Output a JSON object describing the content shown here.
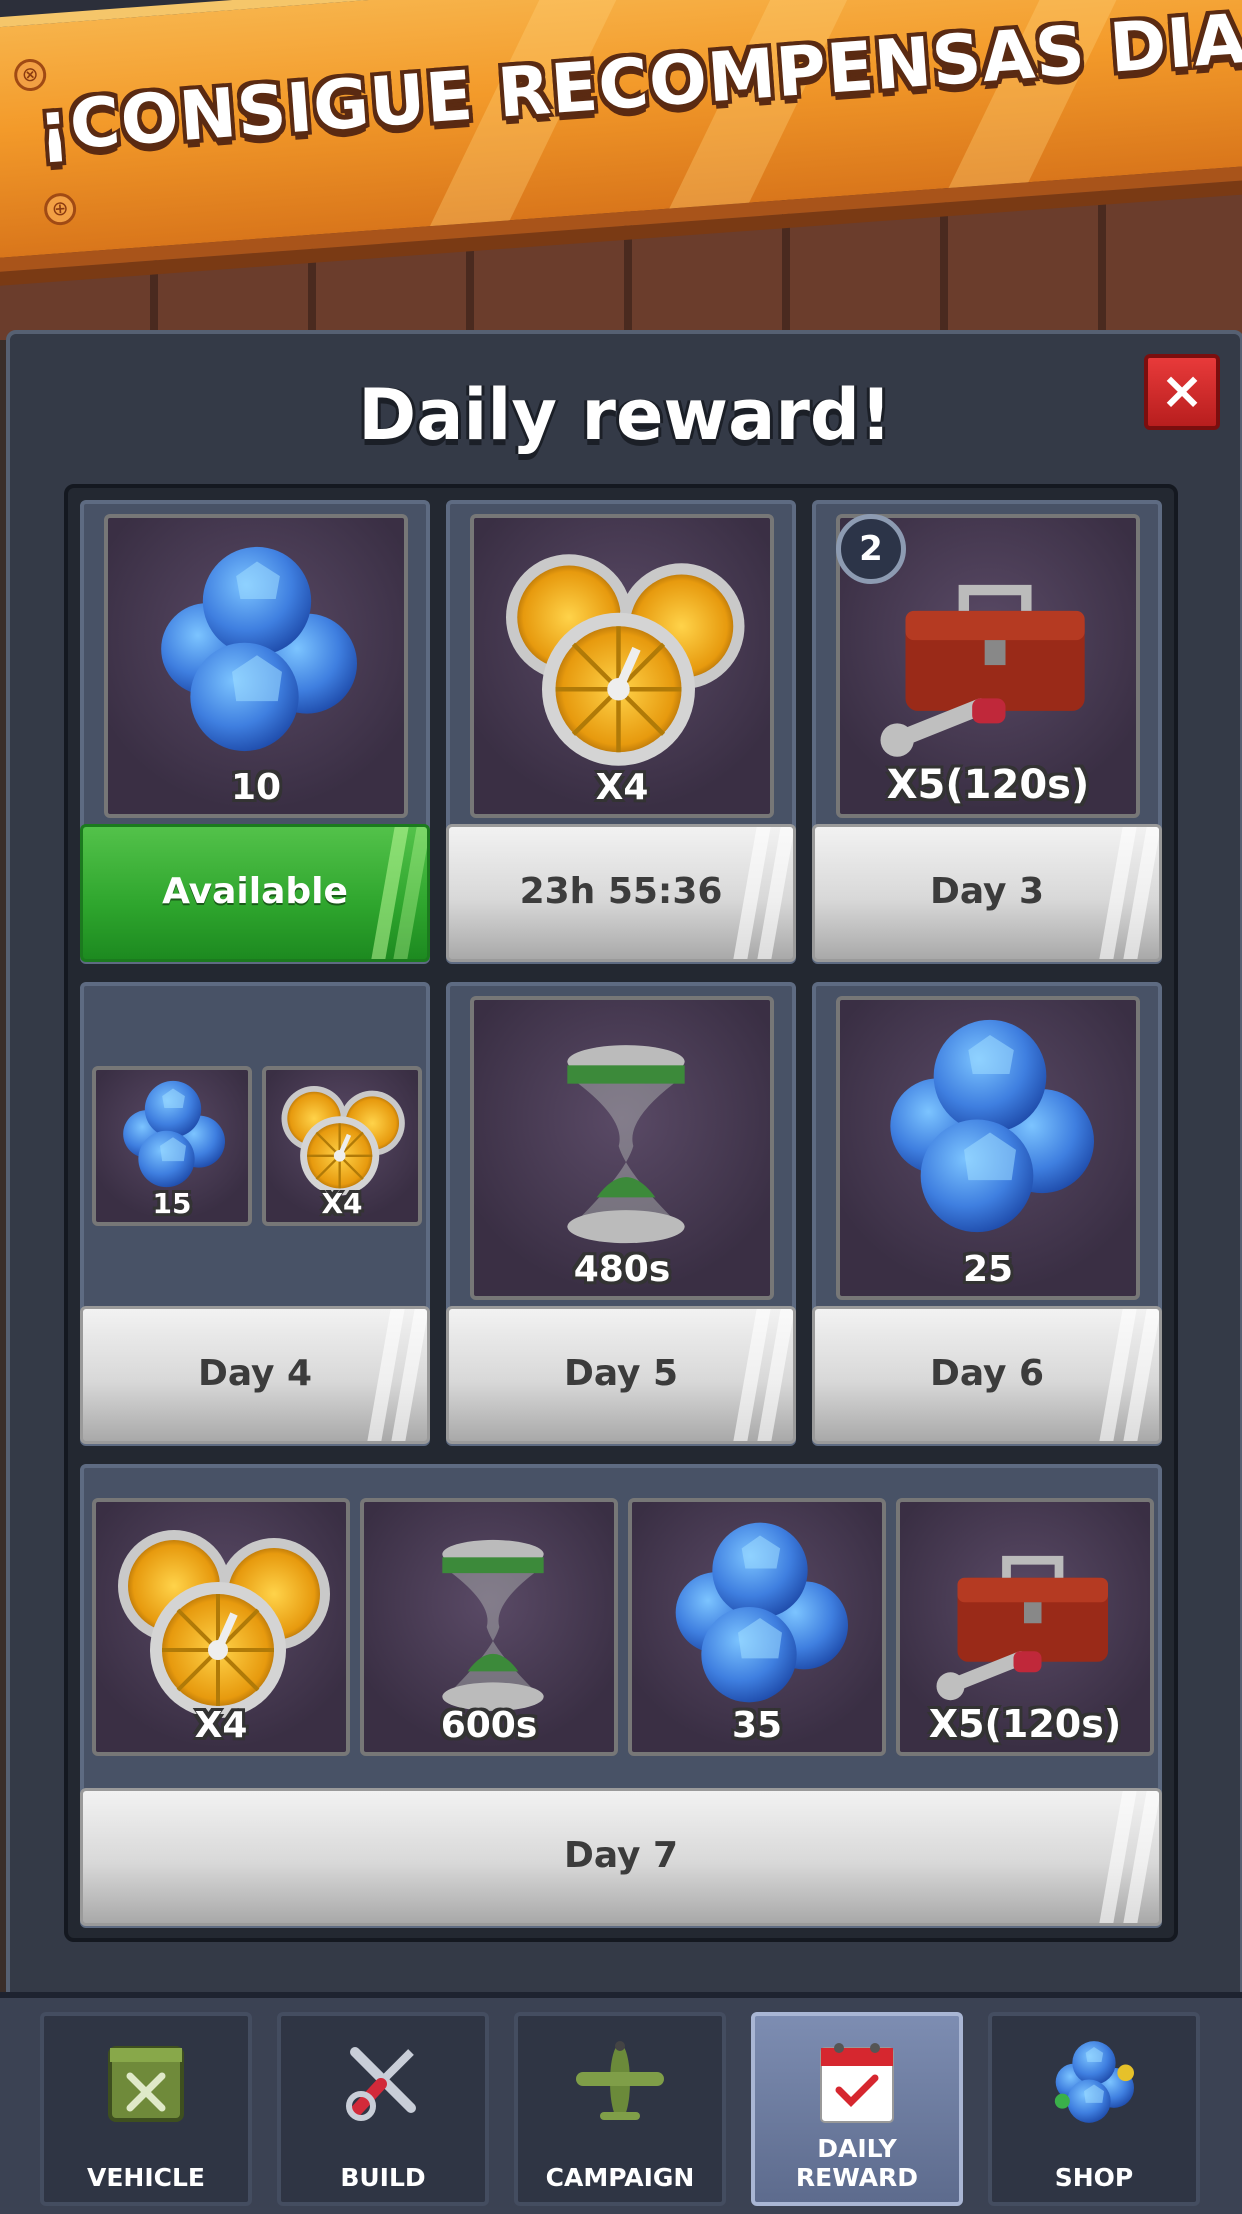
{
  "banner": {
    "text": "¡CONSIGUE RECOMPENSAS DIARIAS!"
  },
  "dialog": {
    "title": "Daily reward!",
    "close_label": "×"
  },
  "days": [
    {
      "reward_qty": "10",
      "button_label": "Available",
      "state": "available"
    },
    {
      "reward_qty": "X4",
      "button_label": "23h 55:36",
      "state": "countdown"
    },
    {
      "reward_qty": "X5(120s)",
      "button_label": "Day 3",
      "badge": "2",
      "state": "locked"
    },
    {
      "reward_qty_a": "15",
      "reward_qty_b": "X4",
      "button_label": "Day 4",
      "state": "locked"
    },
    {
      "reward_qty": "480s",
      "button_label": "Day 5",
      "state": "locked"
    },
    {
      "reward_qty": "25",
      "button_label": "Day 6",
      "state": "locked"
    },
    {
      "rewards": [
        "X4",
        "600s",
        "35",
        "X5(120s)"
      ],
      "button_label": "Day 7",
      "state": "locked"
    }
  ],
  "nav": [
    {
      "label": "VEHICLE",
      "icon": "crate-icon"
    },
    {
      "label": "BUILD",
      "icon": "wrench-screwdriver-icon"
    },
    {
      "label": "CAMPAIGN",
      "icon": "airplane-icon"
    },
    {
      "label": "DAILY REWARD",
      "icon": "calendar-icon",
      "active": true
    },
    {
      "label": "SHOP",
      "icon": "gems-icon"
    }
  ],
  "colors": {
    "available": "#2ea52d",
    "banner": "#f39a2a",
    "close": "#d62a2a",
    "gem": "#3f7fe0"
  }
}
